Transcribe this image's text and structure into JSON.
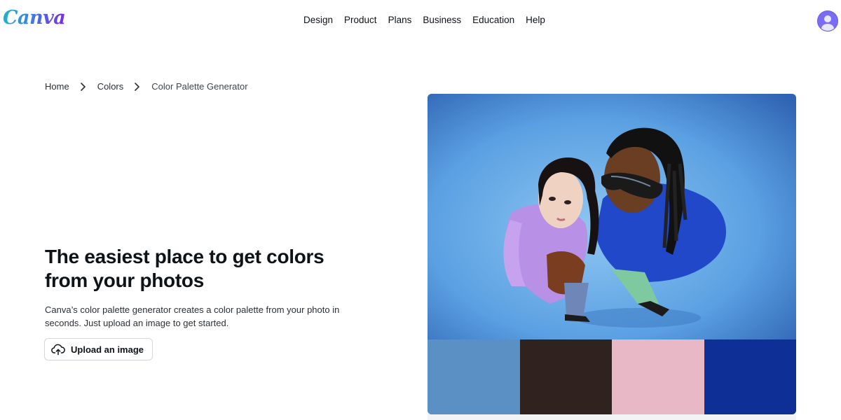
{
  "brand": {
    "logo_text": "Canva"
  },
  "nav": {
    "items": [
      {
        "label": "Design"
      },
      {
        "label": "Product"
      },
      {
        "label": "Plans"
      },
      {
        "label": "Business"
      },
      {
        "label": "Education"
      },
      {
        "label": "Help"
      }
    ]
  },
  "breadcrumb": {
    "items": [
      {
        "label": "Home"
      },
      {
        "label": "Colors"
      },
      {
        "label": "Color Palette Generator"
      }
    ],
    "separator_icon": "chevron-right-icon"
  },
  "hero": {
    "title": "The easiest place to get colors from your photos",
    "description": "Canva’s color palette generator creates a color palette from your photo in seconds. Just upload an image to get started.",
    "upload_label": "Upload an image",
    "upload_icon": "cloud-upload-icon"
  },
  "palette": {
    "colors": [
      "#5b90c4",
      "#30231f",
      "#e8b8c6",
      "#0e2f96"
    ]
  },
  "colors": {
    "photo_background": "#5aa0e2",
    "avatar": "#7b6cf6",
    "text_primary": "#0e1318"
  }
}
